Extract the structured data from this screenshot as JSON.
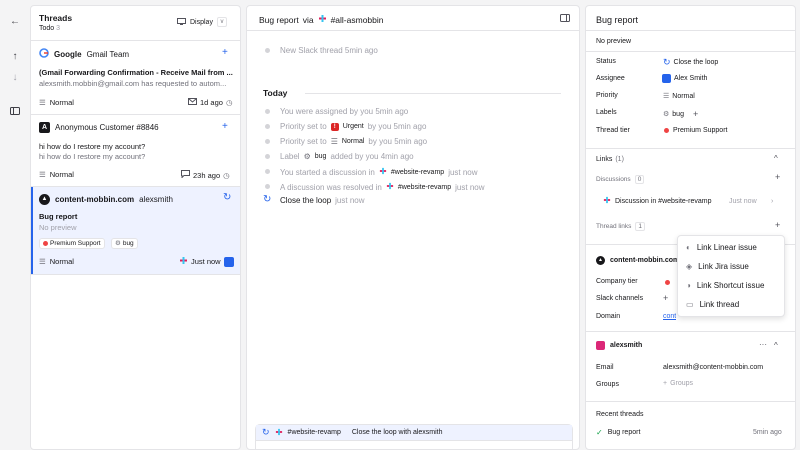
{
  "threads": {
    "title": "Threads",
    "subtitle": "Todo",
    "count": "3",
    "display_label": "Display",
    "items": [
      {
        "org": "Google",
        "customer": "Gmail Team",
        "subject": "(Gmail Forwarding Confirmation - Receive Mail from ...",
        "preview": "alexsmith.mobbin@gmail.com has requested to autom...",
        "priority": "Normal",
        "time": "1d ago"
      },
      {
        "org": "A",
        "customer": "Anonymous Customer #8846",
        "subject": "hi how do I restore my account?",
        "preview": "hi how do I restore my account?",
        "priority": "Normal",
        "time": "23h ago"
      },
      {
        "org": "content-mobbin.com",
        "customer": "alexsmith",
        "subject": "Bug report",
        "preview": "No preview",
        "tier": "Premium Support",
        "label": "bug",
        "priority": "Normal",
        "time": "Just now"
      }
    ]
  },
  "main": {
    "title": "Bug report",
    "via": "via",
    "channel": "#all-asmobbin",
    "first_event": "New Slack thread 5min ago",
    "day_label": "Today",
    "events": [
      {
        "text": "You were assigned by you 5min ago"
      },
      {
        "pre": "Priority set to",
        "tag": "Urgent",
        "post": "by you 5min ago"
      },
      {
        "pre": "Priority set to",
        "tag": "Normal",
        "post": "by you 5min ago"
      },
      {
        "pre": "Label",
        "tag": "bug",
        "post": "added by you 4min ago"
      },
      {
        "pre": "You started a discussion in",
        "tag": "#website-revamp",
        "post": "just now"
      },
      {
        "pre": "A discussion was resolved in",
        "tag": "#website-revamp",
        "post": "just now"
      }
    ],
    "close_loop": "Close the loop",
    "close_loop_time": "just now",
    "composer": {
      "channel": "#website-revamp",
      "text": "Close the loop with alexsmith"
    }
  },
  "side": {
    "title": "Bug report",
    "preview": "No preview",
    "fields": {
      "status_label": "Status",
      "status_value": "Close the loop",
      "assignee_label": "Assignee",
      "assignee_value": "Alex Smith",
      "priority_label": "Priority",
      "priority_value": "Normal",
      "labels_label": "Labels",
      "labels_value": "bug",
      "tier_label": "Thread tier",
      "tier_value": "Premium Support"
    },
    "links": {
      "title": "Links",
      "count": "(1)",
      "discussions_label": "Discussions",
      "discussions_count": "0",
      "discussion_title": "Discussion in #website-revamp",
      "discussion_time": "Just now",
      "thread_links_label": "Thread links",
      "thread_links_count": "1"
    },
    "company": {
      "name": "content-mobbin.com",
      "tier_label": "Company tier",
      "slack_label": "Slack channels",
      "domain_label": "Domain",
      "domain_value": "content-mobbin.com"
    },
    "customer": {
      "name": "alexsmith",
      "email_label": "Email",
      "email_value": "alexsmith@content-mobbin.com",
      "groups_label": "Groups",
      "groups_value": "Groups"
    },
    "recent": {
      "title": "Recent threads",
      "items": [
        {
          "title": "Bug report",
          "time": "5min ago"
        }
      ]
    }
  },
  "menu": {
    "items": [
      "Link Linear issue",
      "Link Jira issue",
      "Link Shortcut issue",
      "Link thread"
    ]
  },
  "colors": {
    "accent": "#2563eb",
    "selected_bg": "#eef2ff",
    "urgent": "#dc2626",
    "premium": "#ef4444"
  }
}
